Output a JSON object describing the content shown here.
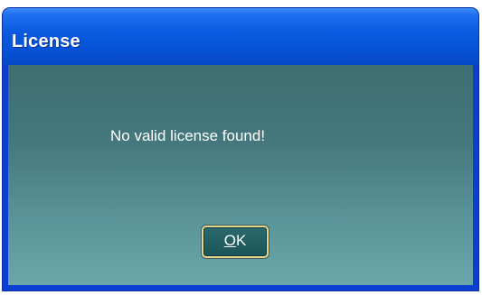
{
  "window": {
    "title": "License"
  },
  "dialog": {
    "message": "No valid license found!",
    "ok_button": {
      "accel": "O",
      "rest": "K"
    }
  }
}
